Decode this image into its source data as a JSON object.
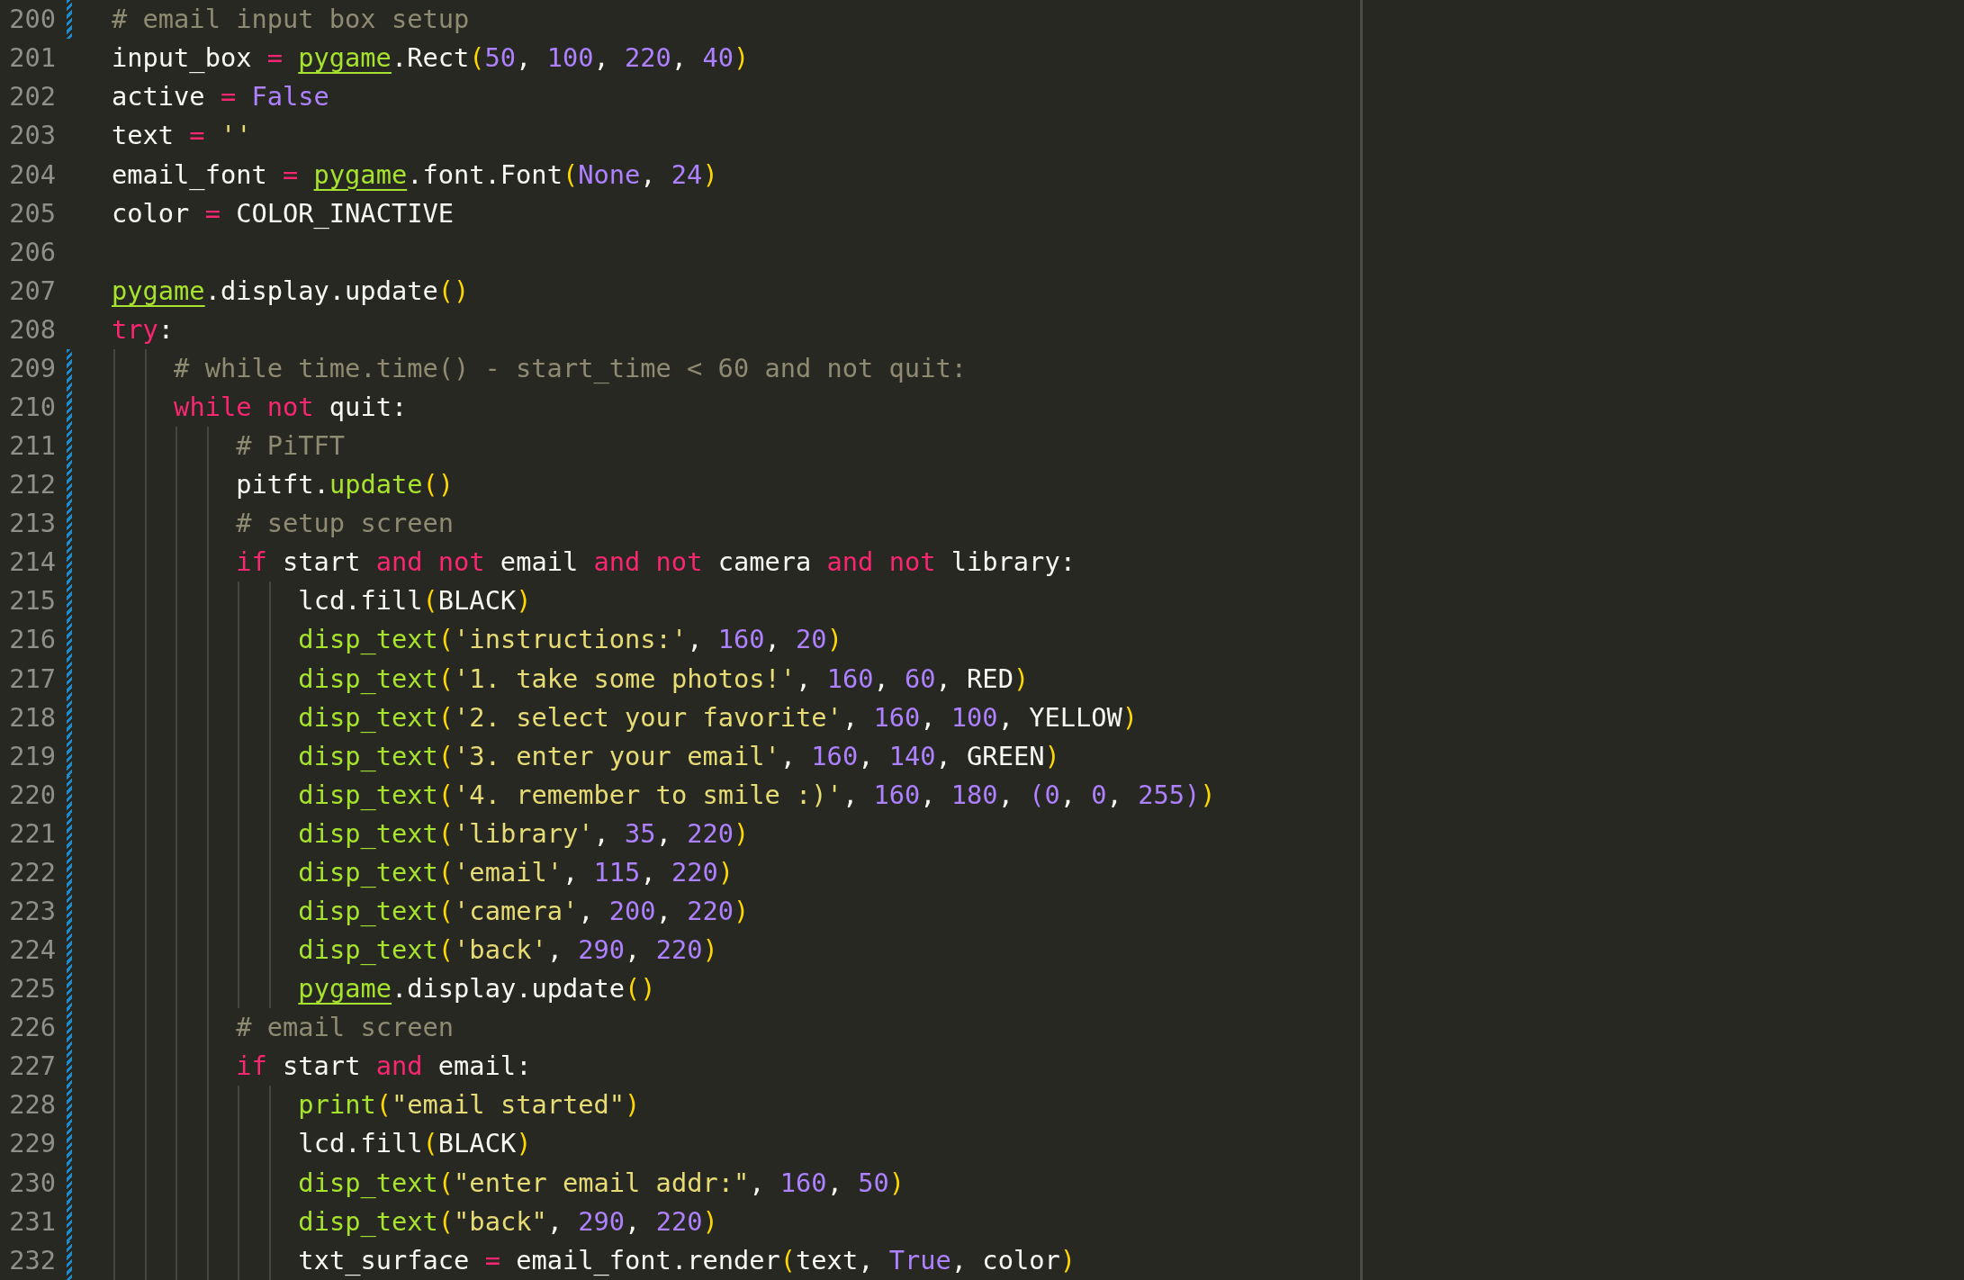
{
  "editor": {
    "lines": [
      {
        "number": "200",
        "modified": true,
        "tokens": [
          {
            "kind": "comment",
            "text": "# email input box setup"
          }
        ]
      },
      {
        "number": "201",
        "modified": false,
        "tokens": [
          {
            "kind": "text",
            "text": "input_box "
          },
          {
            "kind": "keyword",
            "text": "= "
          },
          {
            "kind": "module",
            "text": "pygame"
          },
          {
            "kind": "text",
            "text": ".Rect"
          },
          {
            "kind": "bracket",
            "text": "("
          },
          {
            "kind": "number",
            "text": "50"
          },
          {
            "kind": "text",
            "text": ", "
          },
          {
            "kind": "number",
            "text": "100"
          },
          {
            "kind": "text",
            "text": ", "
          },
          {
            "kind": "number",
            "text": "220"
          },
          {
            "kind": "text",
            "text": ", "
          },
          {
            "kind": "number",
            "text": "40"
          },
          {
            "kind": "bracket",
            "text": ")"
          }
        ]
      },
      {
        "number": "202",
        "modified": false,
        "tokens": [
          {
            "kind": "text",
            "text": "active "
          },
          {
            "kind": "keyword",
            "text": "= "
          },
          {
            "kind": "constant",
            "text": "False"
          }
        ]
      },
      {
        "number": "203",
        "modified": false,
        "tokens": [
          {
            "kind": "text",
            "text": "text "
          },
          {
            "kind": "keyword",
            "text": "= "
          },
          {
            "kind": "string",
            "text": "''"
          }
        ]
      },
      {
        "number": "204",
        "modified": false,
        "tokens": [
          {
            "kind": "text",
            "text": "email_font "
          },
          {
            "kind": "keyword",
            "text": "= "
          },
          {
            "kind": "module",
            "text": "pygame"
          },
          {
            "kind": "text",
            "text": ".font.Font"
          },
          {
            "kind": "bracket",
            "text": "("
          },
          {
            "kind": "constant",
            "text": "None"
          },
          {
            "kind": "text",
            "text": ", "
          },
          {
            "kind": "number",
            "text": "24"
          },
          {
            "kind": "bracket",
            "text": ")"
          }
        ]
      },
      {
        "number": "205",
        "modified": false,
        "tokens": [
          {
            "kind": "text",
            "text": "color "
          },
          {
            "kind": "keyword",
            "text": "="
          },
          {
            "kind": "text",
            "text": " COLOR_INACTIVE"
          }
        ]
      },
      {
        "number": "206",
        "modified": false
      },
      {
        "number": "207",
        "modified": false,
        "tokens": [
          {
            "kind": "module",
            "text": "pygame"
          },
          {
            "kind": "text",
            "text": ".display.update"
          },
          {
            "kind": "bracket",
            "text": "()"
          }
        ]
      },
      {
        "number": "208",
        "modified": false,
        "tokens": [
          {
            "kind": "keyword",
            "text": "try"
          },
          {
            "kind": "text",
            "text": ":"
          }
        ],
        "children": [
          {
            "number": "209",
            "modified": true,
            "tokens": [
              {
                "kind": "comment",
                "text": "# while time.time() - start_time < 60 and not quit:"
              }
            ]
          },
          {
            "number": "210",
            "modified": true,
            "tokens": [
              {
                "kind": "keyword",
                "text": "while not"
              },
              {
                "kind": "text",
                "text": " quit:"
              }
            ],
            "children": [
              {
                "number": "211",
                "modified": true,
                "tokens": [
                  {
                    "kind": "comment",
                    "text": "# PiTFT"
                  }
                ]
              },
              {
                "number": "212",
                "modified": true,
                "tokens": [
                  {
                    "kind": "text",
                    "text": "pitft."
                  },
                  {
                    "kind": "function",
                    "text": "update"
                  },
                  {
                    "kind": "bracket",
                    "text": "()"
                  }
                ]
              },
              {
                "number": "213",
                "modified": true,
                "tokens": [
                  {
                    "kind": "comment",
                    "text": "# setup screen"
                  }
                ]
              },
              {
                "number": "214",
                "modified": true,
                "tokens": [
                  {
                    "kind": "keyword",
                    "text": "if"
                  },
                  {
                    "kind": "text",
                    "text": " start "
                  },
                  {
                    "kind": "keyword",
                    "text": "and not"
                  },
                  {
                    "kind": "text",
                    "text": " email "
                  },
                  {
                    "kind": "keyword",
                    "text": "and not"
                  },
                  {
                    "kind": "text",
                    "text": " camera "
                  },
                  {
                    "kind": "keyword",
                    "text": "and not"
                  },
                  {
                    "kind": "text",
                    "text": " library:"
                  }
                ],
                "children": [
                  {
                    "number": "215",
                    "modified": true,
                    "tokens": [
                      {
                        "kind": "text",
                        "text": "lcd.fill"
                      },
                      {
                        "kind": "bracket",
                        "text": "("
                      },
                      {
                        "kind": "text",
                        "text": "BLACK"
                      },
                      {
                        "kind": "bracket",
                        "text": ")"
                      }
                    ]
                  },
                  {
                    "number": "216",
                    "modified": true,
                    "tokens": [
                      {
                        "kind": "function",
                        "text": "disp_text"
                      },
                      {
                        "kind": "bracket",
                        "text": "("
                      },
                      {
                        "kind": "string",
                        "text": "'instructions:'"
                      },
                      {
                        "kind": "text",
                        "text": ", "
                      },
                      {
                        "kind": "number",
                        "text": "160"
                      },
                      {
                        "kind": "text",
                        "text": ", "
                      },
                      {
                        "kind": "number",
                        "text": "20"
                      },
                      {
                        "kind": "bracket",
                        "text": ")"
                      }
                    ]
                  },
                  {
                    "number": "217",
                    "modified": true,
                    "tokens": [
                      {
                        "kind": "function",
                        "text": "disp_text"
                      },
                      {
                        "kind": "bracket",
                        "text": "("
                      },
                      {
                        "kind": "string",
                        "text": "'1. take some photos!'"
                      },
                      {
                        "kind": "text",
                        "text": ", "
                      },
                      {
                        "kind": "number",
                        "text": "160"
                      },
                      {
                        "kind": "text",
                        "text": ", "
                      },
                      {
                        "kind": "number",
                        "text": "60"
                      },
                      {
                        "kind": "text",
                        "text": ", RED"
                      },
                      {
                        "kind": "bracket",
                        "text": ")"
                      }
                    ]
                  },
                  {
                    "number": "218",
                    "modified": true,
                    "tokens": [
                      {
                        "kind": "function",
                        "text": "disp_text"
                      },
                      {
                        "kind": "bracket",
                        "text": "("
                      },
                      {
                        "kind": "string",
                        "text": "'2. select your favorite'"
                      },
                      {
                        "kind": "text",
                        "text": ", "
                      },
                      {
                        "kind": "number",
                        "text": "160"
                      },
                      {
                        "kind": "text",
                        "text": ", "
                      },
                      {
                        "kind": "number",
                        "text": "100"
                      },
                      {
                        "kind": "text",
                        "text": ", YELLOW"
                      },
                      {
                        "kind": "bracket",
                        "text": ")"
                      }
                    ]
                  },
                  {
                    "number": "219",
                    "modified": true,
                    "tokens": [
                      {
                        "kind": "function",
                        "text": "disp_text"
                      },
                      {
                        "kind": "bracket",
                        "text": "("
                      },
                      {
                        "kind": "string",
                        "text": "'3. enter your email'"
                      },
                      {
                        "kind": "text",
                        "text": ", "
                      },
                      {
                        "kind": "number",
                        "text": "160"
                      },
                      {
                        "kind": "text",
                        "text": ", "
                      },
                      {
                        "kind": "number",
                        "text": "140"
                      },
                      {
                        "kind": "text",
                        "text": ", GREEN"
                      },
                      {
                        "kind": "bracket",
                        "text": ")"
                      }
                    ]
                  },
                  {
                    "number": "220",
                    "modified": true,
                    "tokens": [
                      {
                        "kind": "function",
                        "text": "disp_text"
                      },
                      {
                        "kind": "bracket",
                        "text": "("
                      },
                      {
                        "kind": "string",
                        "text": "'4. remember to smile :)'"
                      },
                      {
                        "kind": "text",
                        "text": ", "
                      },
                      {
                        "kind": "number",
                        "text": "160"
                      },
                      {
                        "kind": "text",
                        "text": ", "
                      },
                      {
                        "kind": "number",
                        "text": "180"
                      },
                      {
                        "kind": "text",
                        "text": ", "
                      },
                      {
                        "kind": "bracket_inner",
                        "text": "("
                      },
                      {
                        "kind": "number",
                        "text": "0"
                      },
                      {
                        "kind": "text",
                        "text": ", "
                      },
                      {
                        "kind": "number",
                        "text": "0"
                      },
                      {
                        "kind": "text",
                        "text": ", "
                      },
                      {
                        "kind": "number",
                        "text": "255"
                      },
                      {
                        "kind": "bracket_inner",
                        "text": ")"
                      },
                      {
                        "kind": "bracket",
                        "text": ")"
                      }
                    ]
                  },
                  {
                    "number": "221",
                    "modified": true,
                    "tokens": [
                      {
                        "kind": "function",
                        "text": "disp_text"
                      },
                      {
                        "kind": "bracket",
                        "text": "("
                      },
                      {
                        "kind": "string",
                        "text": "'library'"
                      },
                      {
                        "kind": "text",
                        "text": ", "
                      },
                      {
                        "kind": "number",
                        "text": "35"
                      },
                      {
                        "kind": "text",
                        "text": ", "
                      },
                      {
                        "kind": "number",
                        "text": "220"
                      },
                      {
                        "kind": "bracket",
                        "text": ")"
                      }
                    ]
                  },
                  {
                    "number": "222",
                    "modified": true,
                    "tokens": [
                      {
                        "kind": "function",
                        "text": "disp_text"
                      },
                      {
                        "kind": "bracket",
                        "text": "("
                      },
                      {
                        "kind": "string",
                        "text": "'email'"
                      },
                      {
                        "kind": "text",
                        "text": ", "
                      },
                      {
                        "kind": "number",
                        "text": "115"
                      },
                      {
                        "kind": "text",
                        "text": ", "
                      },
                      {
                        "kind": "number",
                        "text": "220"
                      },
                      {
                        "kind": "bracket",
                        "text": ")"
                      }
                    ]
                  },
                  {
                    "number": "223",
                    "modified": true,
                    "tokens": [
                      {
                        "kind": "function",
                        "text": "disp_text"
                      },
                      {
                        "kind": "bracket",
                        "text": "("
                      },
                      {
                        "kind": "string",
                        "text": "'camera'"
                      },
                      {
                        "kind": "text",
                        "text": ", "
                      },
                      {
                        "kind": "number",
                        "text": "200"
                      },
                      {
                        "kind": "text",
                        "text": ", "
                      },
                      {
                        "kind": "number",
                        "text": "220"
                      },
                      {
                        "kind": "bracket",
                        "text": ")"
                      }
                    ]
                  },
                  {
                    "number": "224",
                    "modified": true,
                    "tokens": [
                      {
                        "kind": "function",
                        "text": "disp_text"
                      },
                      {
                        "kind": "bracket",
                        "text": "("
                      },
                      {
                        "kind": "string",
                        "text": "'back'"
                      },
                      {
                        "kind": "text",
                        "text": ", "
                      },
                      {
                        "kind": "number",
                        "text": "290"
                      },
                      {
                        "kind": "text",
                        "text": ", "
                      },
                      {
                        "kind": "number",
                        "text": "220"
                      },
                      {
                        "kind": "bracket",
                        "text": ")"
                      }
                    ]
                  },
                  {
                    "number": "225",
                    "modified": true,
                    "tokens": [
                      {
                        "kind": "module",
                        "text": "pygame"
                      },
                      {
                        "kind": "text",
                        "text": ".display.update"
                      },
                      {
                        "kind": "bracket",
                        "text": "()"
                      }
                    ]
                  }
                ]
              },
              {
                "number": "226",
                "modified": true,
                "tokens": [
                  {
                    "kind": "comment",
                    "text": "# email screen"
                  }
                ]
              },
              {
                "number": "227",
                "modified": true,
                "tokens": [
                  {
                    "kind": "keyword",
                    "text": "if"
                  },
                  {
                    "kind": "text",
                    "text": " start "
                  },
                  {
                    "kind": "keyword",
                    "text": "and"
                  },
                  {
                    "kind": "text",
                    "text": " email:"
                  }
                ],
                "children": [
                  {
                    "number": "228",
                    "modified": true,
                    "tokens": [
                      {
                        "kind": "function",
                        "text": "print"
                      },
                      {
                        "kind": "bracket",
                        "text": "("
                      },
                      {
                        "kind": "string",
                        "text": "\"email started\""
                      },
                      {
                        "kind": "bracket",
                        "text": ")"
                      }
                    ]
                  },
                  {
                    "number": "229",
                    "modified": true,
                    "tokens": [
                      {
                        "kind": "text",
                        "text": "lcd.fill"
                      },
                      {
                        "kind": "bracket",
                        "text": "("
                      },
                      {
                        "kind": "text",
                        "text": "BLACK"
                      },
                      {
                        "kind": "bracket",
                        "text": ")"
                      }
                    ]
                  },
                  {
                    "number": "230",
                    "modified": true,
                    "tokens": [
                      {
                        "kind": "function",
                        "text": "disp_text"
                      },
                      {
                        "kind": "bracket",
                        "text": "("
                      },
                      {
                        "kind": "string",
                        "text": "\"enter email addr:\""
                      },
                      {
                        "kind": "text",
                        "text": ", "
                      },
                      {
                        "kind": "number",
                        "text": "160"
                      },
                      {
                        "kind": "text",
                        "text": ", "
                      },
                      {
                        "kind": "number",
                        "text": "50"
                      },
                      {
                        "kind": "bracket",
                        "text": ")"
                      }
                    ]
                  },
                  {
                    "number": "231",
                    "modified": true,
                    "tokens": [
                      {
                        "kind": "function",
                        "text": "disp_text"
                      },
                      {
                        "kind": "bracket",
                        "text": "("
                      },
                      {
                        "kind": "string",
                        "text": "\"back\""
                      },
                      {
                        "kind": "text",
                        "text": ", "
                      },
                      {
                        "kind": "number",
                        "text": "290"
                      },
                      {
                        "kind": "text",
                        "text": ", "
                      },
                      {
                        "kind": "number",
                        "text": "220"
                      },
                      {
                        "kind": "bracket",
                        "text": ")"
                      }
                    ]
                  },
                  {
                    "number": "232",
                    "modified": true,
                    "tokens": [
                      {
                        "kind": "text",
                        "text": "txt_surface "
                      },
                      {
                        "kind": "keyword",
                        "text": "="
                      },
                      {
                        "kind": "text",
                        "text": " email_font.render"
                      },
                      {
                        "kind": "bracket",
                        "text": "("
                      },
                      {
                        "kind": "text",
                        "text": "text, "
                      },
                      {
                        "kind": "constant",
                        "text": "True"
                      },
                      {
                        "kind": "text",
                        "text": ", color"
                      },
                      {
                        "kind": "bracket",
                        "text": ")"
                      }
                    ]
                  }
                ]
              }
            ]
          }
        ]
      }
    ]
  }
}
